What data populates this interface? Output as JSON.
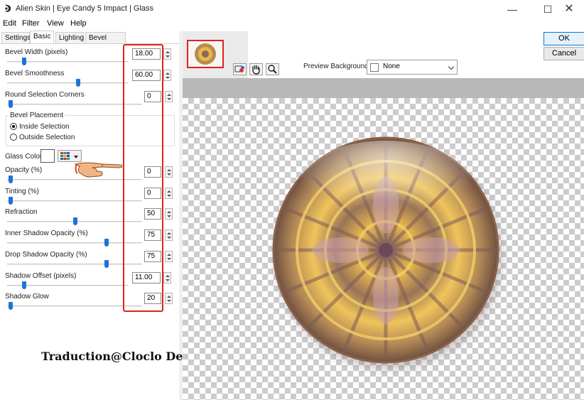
{
  "window": {
    "title": "Alien Skin | Eye Candy 5 Impact | Glass",
    "controls": {
      "minimize": "—",
      "maximize": "☐",
      "close": "✕"
    }
  },
  "menu": [
    "Edit",
    "Filter",
    "View",
    "Help"
  ],
  "tabs": [
    "Settings",
    "Basic",
    "Lighting",
    "Bevel Profile"
  ],
  "active_tab": "Basic",
  "params": [
    {
      "label": "Bevel Width (pixels)",
      "value": "18.00",
      "level": 0.12
    },
    {
      "label": "Bevel Smoothness",
      "value": "60.00",
      "level": 0.6
    },
    {
      "label": "Round Selection Corners",
      "value": "0",
      "level": 0.0
    },
    {
      "label": "Opacity (%)",
      "value": "0",
      "level": 0.0
    },
    {
      "label": "Tinting (%)",
      "value": "0",
      "level": 0.0
    },
    {
      "label": "Refraction",
      "value": "50",
      "level": 0.5
    },
    {
      "label": "Inner Shadow Opacity (%)",
      "value": "75",
      "level": 0.75
    },
    {
      "label": "Drop Shadow Opacity (%)",
      "value": "75",
      "level": 0.75
    },
    {
      "label": "Shadow Offset (pixels)",
      "value": "11.00",
      "level": 0.11
    },
    {
      "label": "Shadow Glow",
      "value": "20",
      "level": 0.0
    }
  ],
  "bevel_placement": {
    "title": "Bevel Placement",
    "options": [
      "Inside Selection",
      "Outside Selection"
    ],
    "selected": "Inside Selection"
  },
  "glass_color": {
    "label": "Glass Color",
    "value": "#ffffff"
  },
  "preview_background": {
    "label": "Preview Background:",
    "value": "None"
  },
  "buttons": {
    "ok": "OK",
    "cancel": "Cancel"
  },
  "watermark": "Traduction@Cloclo Design",
  "colors": {
    "accent": "#1e73d6",
    "highlight": "#e32119",
    "orb_gold": "#e8b84a",
    "orb_brown": "#8a6a4c"
  },
  "icons": [
    "app-logo-icon",
    "pan-hand-icon",
    "zoom-icon",
    "compare-icon",
    "color-grid-icon",
    "pointing-hand-icon"
  ]
}
